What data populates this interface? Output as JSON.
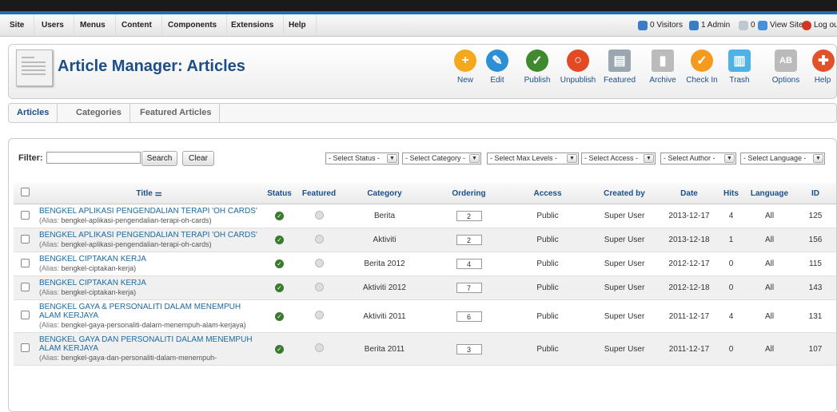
{
  "topmenu": {
    "items": [
      "Site",
      "Users",
      "Menus",
      "Content",
      "Components",
      "Extensions",
      "Help"
    ]
  },
  "status": {
    "visitors": "0 Visitors",
    "admins": "1 Admin",
    "messages": "0",
    "view_site": "View Site",
    "logout": "Log out"
  },
  "header": {
    "title": "Article Manager: Articles"
  },
  "toolbar": {
    "buttons": [
      {
        "label": "New",
        "icon": "new-icon",
        "color": "#f5a81c"
      },
      {
        "label": "Edit",
        "icon": "edit-icon",
        "color": "#2d8fd6"
      },
      {
        "label": "Publish",
        "icon": "publish-icon",
        "color": "#3f8a2f"
      },
      {
        "label": "Unpublish",
        "icon": "unpublish-icon",
        "color": "#e34a23"
      },
      {
        "label": "Featured",
        "icon": "featured-icon",
        "color": "#9aa7b0"
      },
      {
        "label": "Archive",
        "icon": "archive-icon",
        "color": "#bbbbbb"
      },
      {
        "label": "Check In",
        "icon": "checkin-icon",
        "color": "#f49b1f"
      },
      {
        "label": "Trash",
        "icon": "trash-icon",
        "color": "#4db3e6"
      },
      {
        "label": "Options",
        "icon": "options-icon",
        "color": "#bbbbbb"
      },
      {
        "label": "Help",
        "icon": "help-icon",
        "color": "#e2522a"
      }
    ]
  },
  "subnav": {
    "tabs": [
      "Articles",
      "Categories",
      "Featured Articles"
    ],
    "active": "Articles"
  },
  "filter": {
    "label": "Filter:",
    "value": "",
    "search_label": "Search",
    "clear_label": "Clear",
    "selects": [
      "- Select Status -",
      "- Select Category -",
      "- Select Max Levels -",
      "- Select Access -",
      "- Select Author -",
      "- Select Language -"
    ]
  },
  "table": {
    "columns": [
      "Title",
      "Status",
      "Featured",
      "Category",
      "Ordering",
      "Access",
      "Created by",
      "Date",
      "Hits",
      "Language",
      "ID"
    ],
    "alias_label": "(Alias:",
    "rows": [
      {
        "title": "BENGKEL APLIKASI PENGENDALIAN TERAPI 'OH CARDS'",
        "alias": "bengkel-aplikasi-pengendalian-terapi-oh-cards)",
        "category": "Berita",
        "ordering": "2",
        "access": "Public",
        "created_by": "Super User",
        "date": "2013-12-17",
        "hits": "4",
        "language": "All",
        "id": "125"
      },
      {
        "title": "BENGKEL APLIKASI PENGENDALIAN TERAPI 'OH CARDS'",
        "alias": "bengkel-aplikasi-pengendalian-terapi-oh-cards)",
        "category": "Aktiviti",
        "ordering": "2",
        "access": "Public",
        "created_by": "Super User",
        "date": "2013-12-18",
        "hits": "1",
        "language": "All",
        "id": "156"
      },
      {
        "title": "BENGKEL CIPTAKAN KERJA",
        "alias": "bengkel-ciptakan-kerja)",
        "category": "Berita 2012",
        "ordering": "4",
        "access": "Public",
        "created_by": "Super User",
        "date": "2012-12-17",
        "hits": "0",
        "language": "All",
        "id": "115"
      },
      {
        "title": "BENGKEL CIPTAKAN KERJA",
        "alias": "bengkel-ciptakan-kerja)",
        "category": "Aktiviti 2012",
        "ordering": "7",
        "access": "Public",
        "created_by": "Super User",
        "date": "2012-12-18",
        "hits": "0",
        "language": "All",
        "id": "143"
      },
      {
        "title": "BENGKEL GAYA & PERSONALITI DALAM MENEMPUH ALAM KERJAYA",
        "alias": "bengkel-gaya-personaliti-dalam-menempuh-alam-kerjaya)",
        "category": "Aktiviti 2011",
        "ordering": "6",
        "access": "Public",
        "created_by": "Super User",
        "date": "2011-12-17",
        "hits": "4",
        "language": "All",
        "id": "131"
      },
      {
        "title": "BENGKEL GAYA DAN PERSONALITI DALAM MENEMPUH ALAM KERJAYA",
        "alias": "bengkel-gaya-dan-personaliti-dalam-menempuh-",
        "category": "Berita 2011",
        "ordering": "3",
        "access": "Public",
        "created_by": "Super User",
        "date": "2011-12-17",
        "hits": "0",
        "language": "All",
        "id": "107"
      }
    ]
  }
}
